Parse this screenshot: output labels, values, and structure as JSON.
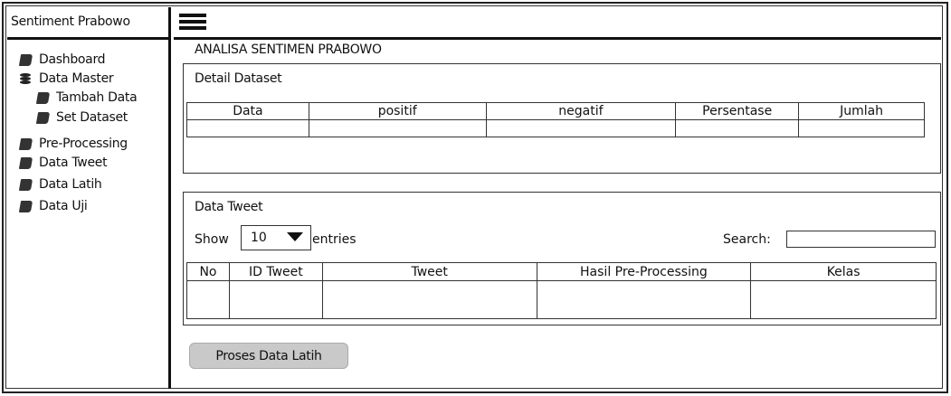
{
  "app": {
    "brand": "Sentiment Prabowo"
  },
  "sidebar": {
    "items": [
      {
        "label": "Dashboard",
        "icon": "book-icon"
      },
      {
        "label": "Data Master",
        "icon": "database-icon"
      },
      {
        "label": "Tambah Data",
        "icon": "book-icon"
      },
      {
        "label": "Set Dataset",
        "icon": "book-icon"
      },
      {
        "label": "Pre-Processing",
        "icon": "book-icon"
      },
      {
        "label": "Data Tweet",
        "icon": "book-icon"
      },
      {
        "label": "Data Latih",
        "icon": "book-icon"
      },
      {
        "label": "Data Uji",
        "icon": "book-icon"
      }
    ]
  },
  "topbar": {
    "menu_icon": "hamburger-icon"
  },
  "main": {
    "title": "ANALISA SENTIMEN PRABOWO",
    "detail": {
      "title": "Detail Dataset",
      "headers": [
        "Data",
        "positif",
        "negatif",
        "Persentase",
        "Jumlah"
      ]
    },
    "tweets": {
      "title": "Data Tweet",
      "show_label": "Show",
      "entries_value": "10",
      "entries_label": "entries",
      "search_label": "Search:",
      "search_value": "",
      "headers": [
        "No",
        "ID Tweet",
        "Tweet",
        "Hasil Pre-Processing",
        "Kelas"
      ]
    },
    "action_button": "Proses Data Latih"
  }
}
